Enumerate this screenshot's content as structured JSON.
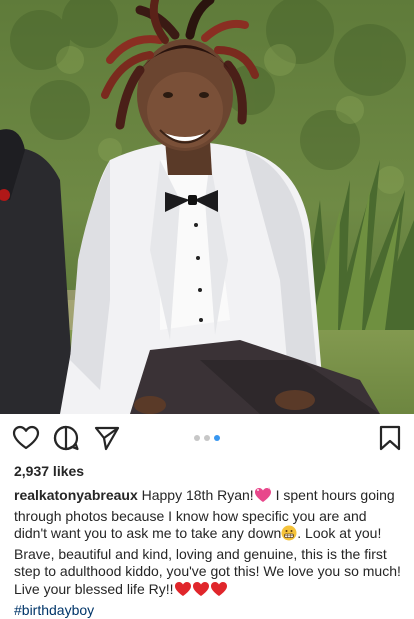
{
  "post": {
    "likes": "2,937 likes",
    "username": "realkatonyabreaux",
    "caption_1": " Happy 18th Ryan!",
    "caption_2": " I spent hours going through photos because I know how specific you are and didn't want you to ask me to take any down",
    "caption_3": ". Look at you! Brave, beautiful and kind, loving and genuine, this is the first step to adulthood kiddo, you've got this! We love you so much! Live your blessed life Ry!!",
    "hashtag": "#birthdayboy",
    "carousel": {
      "count": 3,
      "active_index": 2
    }
  },
  "icons": [
    "heart-icon",
    "comment-icon",
    "share-icon",
    "bookmark-icon",
    "sparkling-heart-emoji",
    "grimacing-emoji",
    "red-heart-emoji"
  ],
  "colors": {
    "text": "#262626",
    "link": "#003569",
    "dot_active": "#3897f0",
    "dot_inactive": "#c7c7c7"
  }
}
